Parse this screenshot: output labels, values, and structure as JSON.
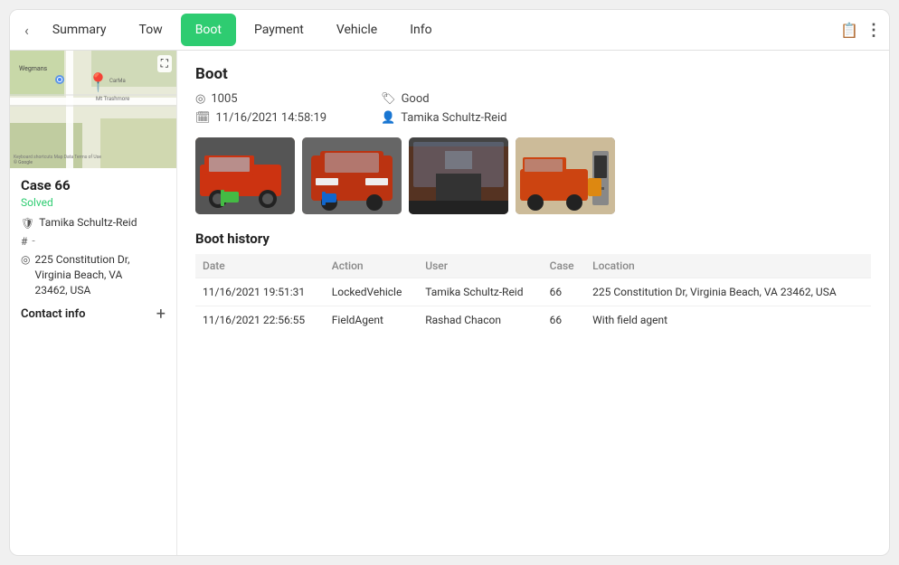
{
  "tabs": [
    {
      "id": "summary",
      "label": "Summary",
      "active": false
    },
    {
      "id": "tow",
      "label": "Tow",
      "active": false
    },
    {
      "id": "boot",
      "label": "Boot",
      "active": true
    },
    {
      "id": "payment",
      "label": "Payment",
      "active": false
    },
    {
      "id": "vehicle",
      "label": "Vehicle",
      "active": false
    },
    {
      "id": "info",
      "label": "Info",
      "active": false
    }
  ],
  "sidebar": {
    "case_title": "Case 66",
    "status": "Solved",
    "agent": "Tamika Schultz-Reid",
    "hash_value": "-",
    "address": "225 Constitution Dr,\nVirginia Beach, VA\n23462, USA",
    "contact_label": "Contact info"
  },
  "boot": {
    "section_title": "Boot",
    "boot_number": "1005",
    "datetime": "11/16/2021 14:58:19",
    "condition": "Good",
    "agent": "Tamika Schultz-Reid",
    "history_title": "Boot history",
    "history_columns": [
      "Date",
      "Action",
      "User",
      "Case",
      "Location"
    ],
    "history_rows": [
      {
        "date": "11/16/2021 19:51:31",
        "action": "LockedVehicle",
        "user": "Tamika Schultz-Reid",
        "case": "66",
        "location": "225 Constitution Dr, Virginia Beach, VA 23462, USA"
      },
      {
        "date": "11/16/2021 22:56:55",
        "action": "FieldAgent",
        "user": "Rashad Chacon",
        "case": "66",
        "location": "With field agent"
      }
    ]
  },
  "photos": [
    {
      "label": "Photo 1",
      "color": "#8B5E52"
    },
    {
      "label": "Photo 2",
      "color": "#7A6050"
    },
    {
      "label": "Photo 3",
      "color": "#6A5545"
    },
    {
      "label": "Photo 4",
      "color": "#9B7060"
    }
  ],
  "icons": {
    "back": "‹",
    "clipboard": "📋",
    "dots": "⋮",
    "expand": "⛶",
    "pin": "📍",
    "shield": "🛡",
    "hash": "#",
    "location": "📍",
    "circle_dot": "◎",
    "calendar": "🗓",
    "person": "👤",
    "tag": "🏷",
    "plus": "+"
  }
}
